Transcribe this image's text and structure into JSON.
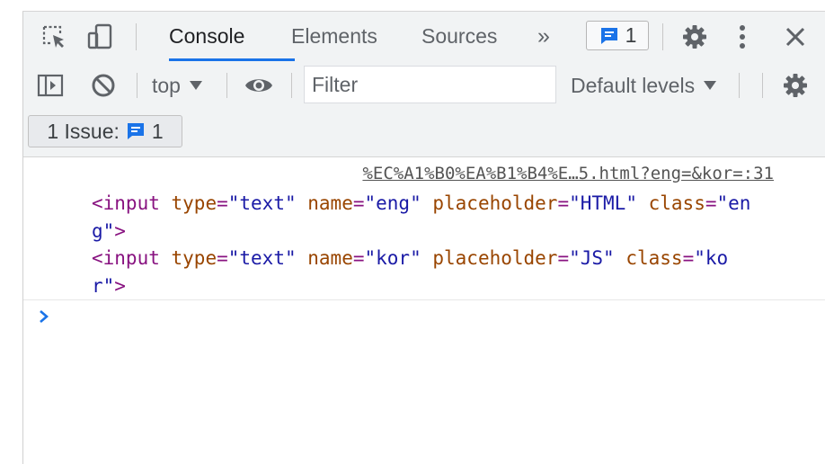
{
  "tabs": {
    "console": "Console",
    "elements": "Elements",
    "sources": "Sources",
    "more": "»",
    "issues_count": "1"
  },
  "toolbar": {
    "context": "top",
    "filter_placeholder": "Filter",
    "levels": "Default levels"
  },
  "issues_bar": {
    "label": "1 Issue:",
    "count": "1"
  },
  "log": {
    "source": "%EC%A1%B0%EA%B1%B4%E…5.html?eng=&kor=:31",
    "line1": {
      "open": "<input",
      "attr1": "type",
      "val1": "\"text\"",
      "attr2": "name",
      "val2": "\"eng\"",
      "attr3": "placeholder",
      "val3": "\"HTML\"",
      "attr4": "class",
      "val4a": "\"en",
      "val4b": "g\"",
      "close": ">"
    },
    "line2": {
      "open": "<input",
      "attr1": "type",
      "val1": "\"text\"",
      "attr2": "name",
      "val2": "\"kor\"",
      "attr3": "placeholder",
      "val3": "\"JS\"",
      "attr4": "class",
      "val4a": "\"ko",
      "val4b": "r\"",
      "close": ">"
    }
  },
  "icons": {
    "inspect": "inspect-element-icon",
    "device": "device-toolbar-icon",
    "settings": "gear-icon",
    "menu": "vertical-dots-icon",
    "close": "close-icon",
    "sidebar": "sidebar-toggle-icon",
    "clear": "clear-console-icon",
    "eye": "live-expression-eye-icon",
    "message": "message-icon",
    "prompt": "chevron-right-icon"
  },
  "colors": {
    "accent": "#1a73e8",
    "tag": "#881280",
    "attribute": "#994500",
    "value": "#1a1aa6",
    "icon": "#5f6368"
  }
}
